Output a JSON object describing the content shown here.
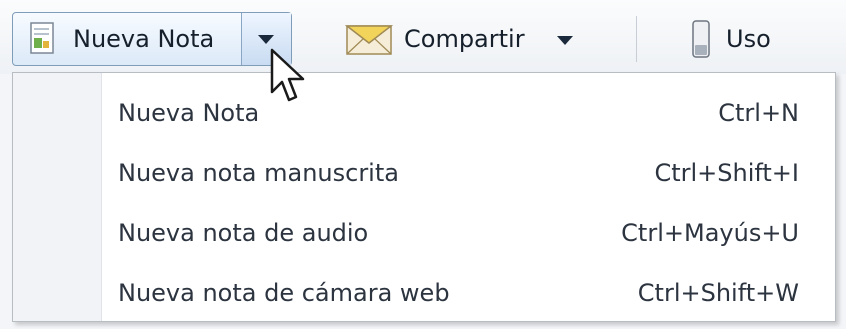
{
  "toolbar": {
    "new_note_label": "Nueva Nota",
    "share_label": "Compartir",
    "usage_label": "Uso"
  },
  "menu": {
    "items": [
      {
        "label": "Nueva Nota",
        "shortcut": "Ctrl+N"
      },
      {
        "label": "Nueva nota manuscrita",
        "shortcut": "Ctrl+Shift+I"
      },
      {
        "label": "Nueva nota de audio",
        "shortcut": "Ctrl+Mayús+U"
      },
      {
        "label": "Nueva nota de cámara web",
        "shortcut": "Ctrl+Shift+W"
      }
    ]
  },
  "icons": {
    "new_note": "note-icon",
    "share": "envelope-icon",
    "usage": "usage-meter-icon",
    "cursor": "mouse-pointer-icon"
  },
  "colors": {
    "split_button_border": "#7f9db9",
    "menu_background": "#ffffff",
    "text": "#2c3440"
  }
}
